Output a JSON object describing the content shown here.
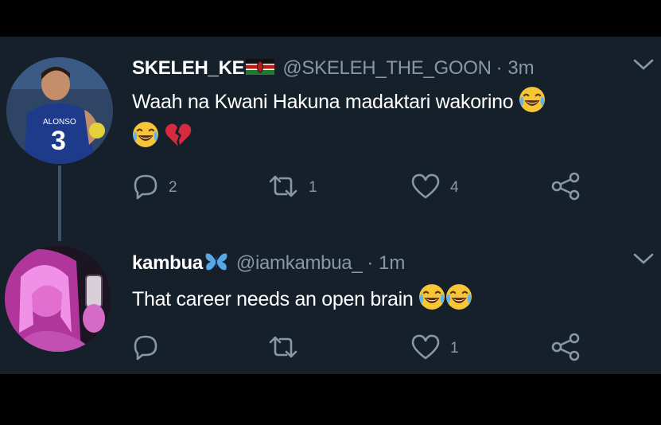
{
  "tweets": [
    {
      "name": "SKELEH_KE",
      "handle": "@SKELEH_THE_GOON",
      "time": "· 3m",
      "text": "Waah na Kwani Hakuna madaktari wakorino",
      "avatar": "footballer-avatar",
      "name_icon": "kenya-flag-icon",
      "text_emojis": [
        "tears-of-joy-emoji",
        "tears-of-joy-emoji",
        "broken-heart-emoji"
      ],
      "counts": {
        "replies": "2",
        "retweets": "1",
        "likes": "4"
      }
    },
    {
      "name": "kambua",
      "handle": "@iamkambua_",
      "time": "· 1m",
      "text": "That career needs an open brain",
      "avatar": "profile-photo-avatar",
      "name_icon": "butterfly-icon",
      "text_emojis": [
        "tears-of-joy-emoji",
        "tears-of-joy-emoji"
      ],
      "counts": {
        "replies": "",
        "retweets": "",
        "likes": "1"
      }
    }
  ],
  "colors": {
    "background": "#15202b",
    "secondary_text": "#8899a6",
    "primary_text": "#ffffff"
  }
}
